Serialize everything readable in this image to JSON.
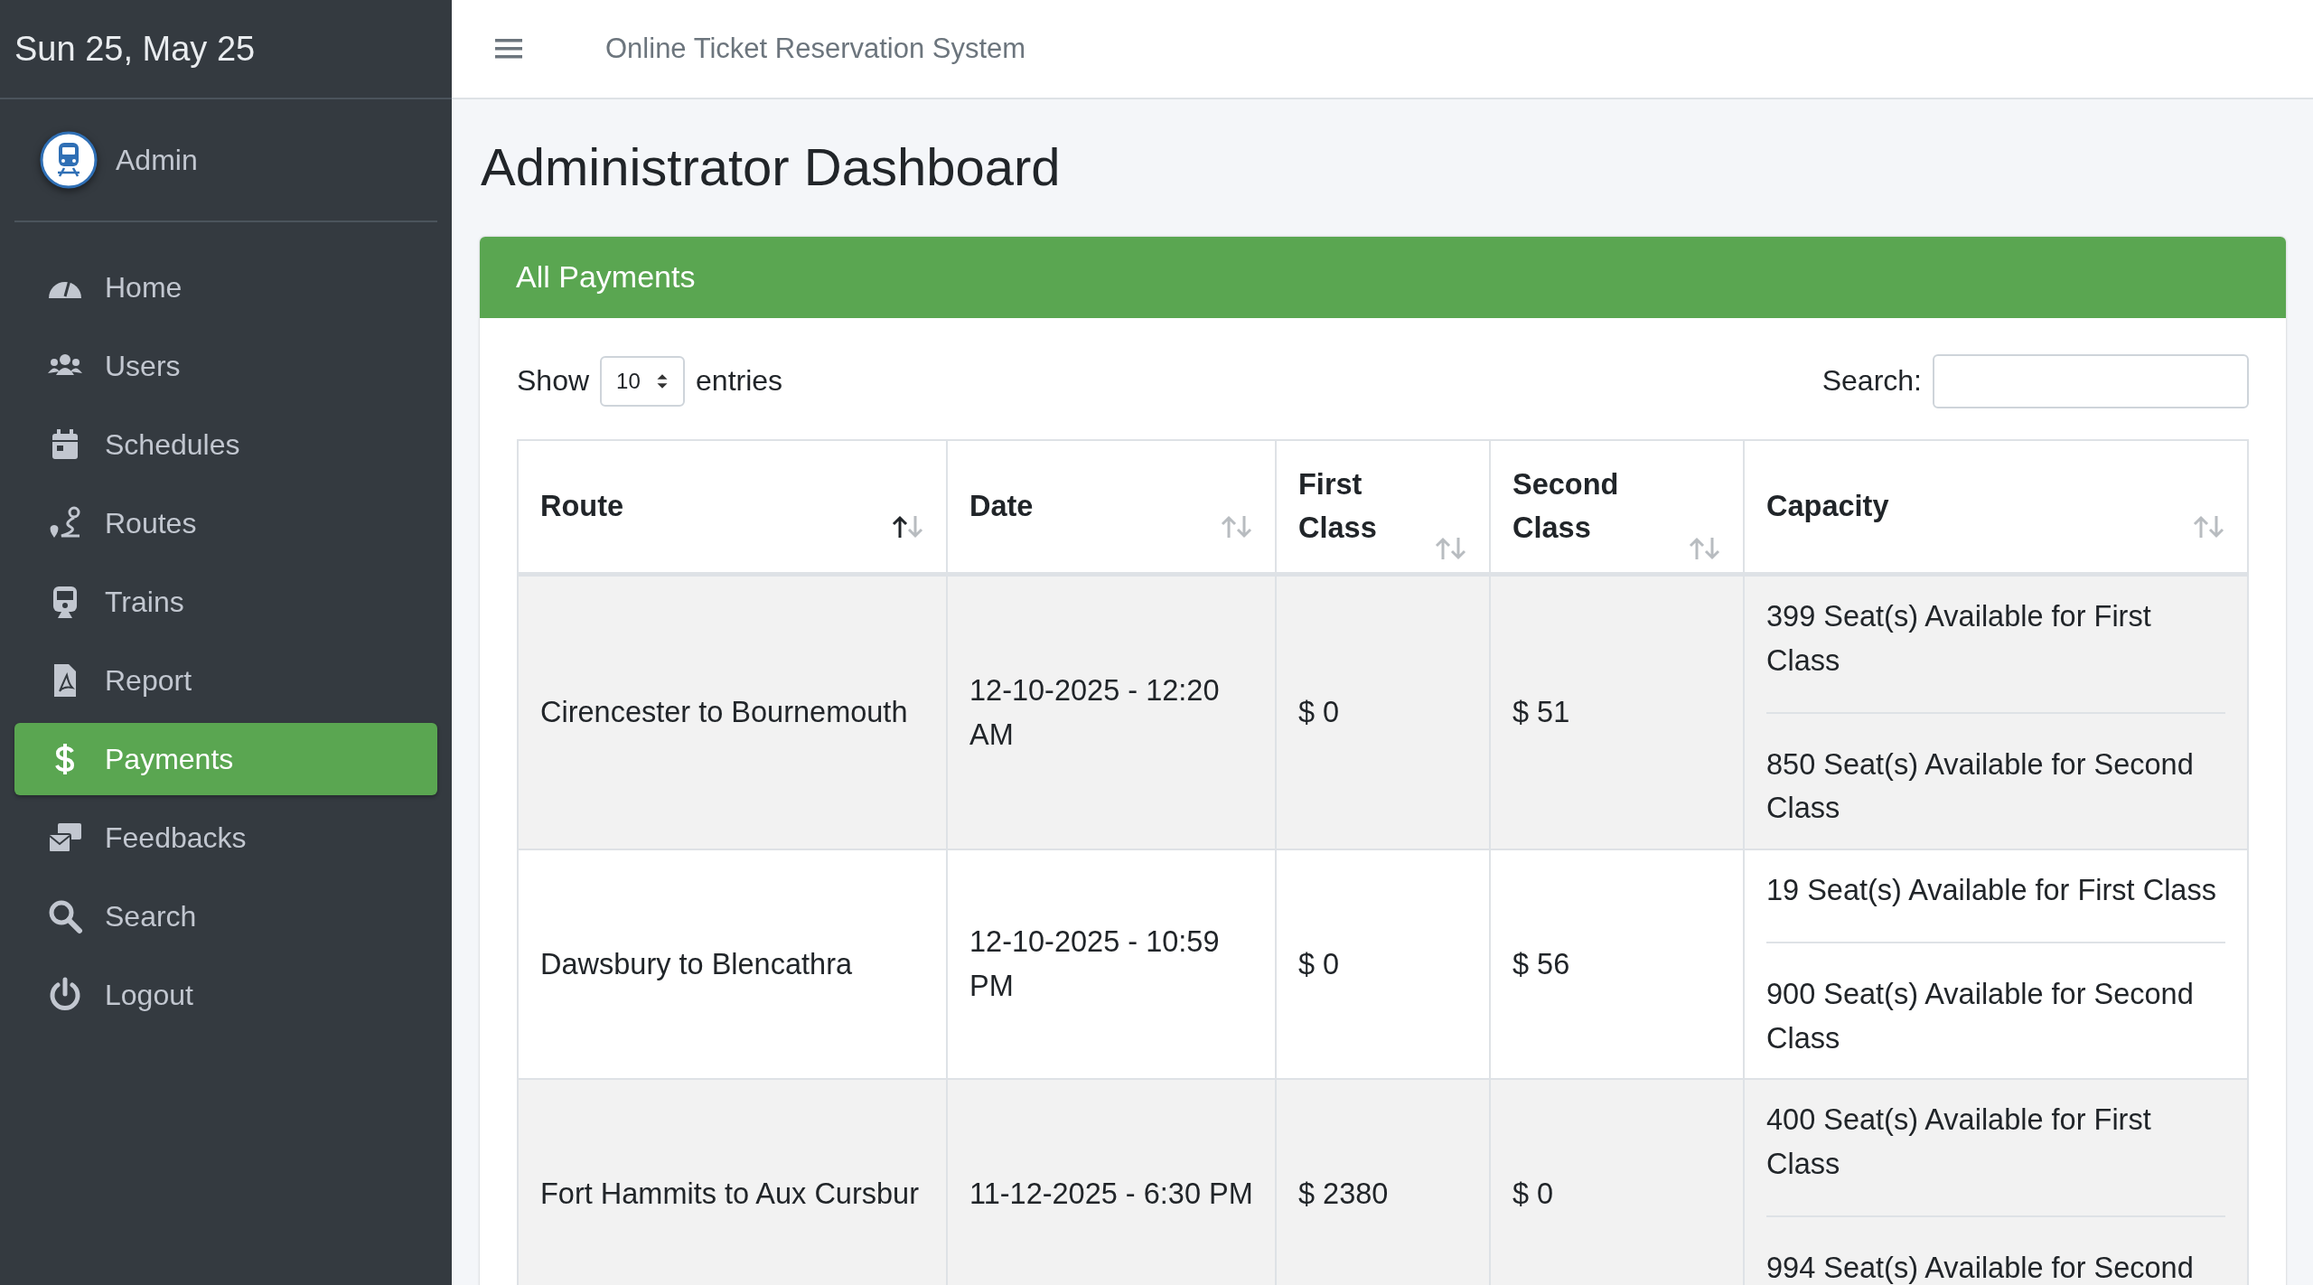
{
  "sidebar": {
    "date": "Sun 25, May 25",
    "user": "Admin",
    "items": [
      {
        "label": "Home",
        "selected": false
      },
      {
        "label": "Users",
        "selected": false
      },
      {
        "label": "Schedules",
        "selected": false
      },
      {
        "label": "Routes",
        "selected": false
      },
      {
        "label": "Trains",
        "selected": false
      },
      {
        "label": "Report",
        "selected": false
      },
      {
        "label": "Payments",
        "selected": true
      },
      {
        "label": "Feedbacks",
        "selected": false
      },
      {
        "label": "Search",
        "selected": false
      },
      {
        "label": "Logout",
        "selected": false
      }
    ]
  },
  "header": {
    "title": "Online Ticket Reservation System"
  },
  "page_title": "Administrator Dashboard",
  "card": {
    "title": "All Payments",
    "length": {
      "label_before": "Show",
      "value": "10",
      "label_after": "entries"
    },
    "search": {
      "label": "Search:"
    },
    "table": {
      "columns": [
        {
          "label": "Route",
          "sorted": true
        },
        {
          "label": "Date",
          "sorted": false
        },
        {
          "label": "First Class",
          "sorted": false
        },
        {
          "label": "Second Class",
          "sorted": false
        },
        {
          "label": "Capacity",
          "sorted": false
        }
      ],
      "rows": [
        {
          "route": "Cirencester to Bournemouth",
          "date": "12-10-2025 - 12:20 AM",
          "first": "$ 0",
          "second": "$ 51",
          "capacity": [
            "399 Seat(s) Available for First Class",
            "850 Seat(s) Available for Second Class"
          ]
        },
        {
          "route": "Dawsbury to Blencathra",
          "date": "12-10-2025 - 10:59 PM",
          "first": "$ 0",
          "second": "$ 56",
          "capacity": [
            "19 Seat(s) Available for First Class",
            "900 Seat(s) Available for Second Class"
          ]
        },
        {
          "route": "Fort Hammits to Aux Cursbur",
          "date": "11-12-2025 - 6:30 PM",
          "first": "$ 2380",
          "second": "$ 0",
          "capacity": [
            "400 Seat(s) Available for First Class",
            "994 Seat(s) Available for Second"
          ]
        }
      ]
    }
  }
}
